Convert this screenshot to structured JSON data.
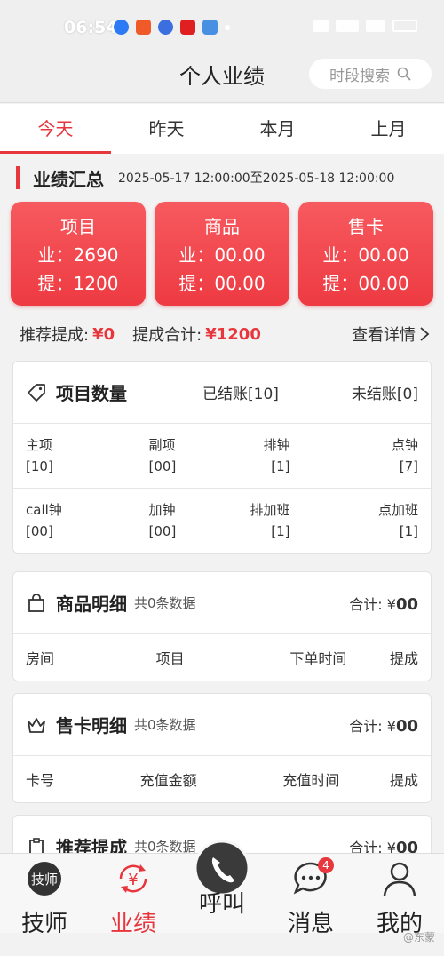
{
  "status": {
    "time": "06:54"
  },
  "header": {
    "title": "个人业绩",
    "search_label": "时段搜索"
  },
  "tabs": [
    {
      "label": "今天",
      "active": true
    },
    {
      "label": "昨天",
      "active": false
    },
    {
      "label": "本月",
      "active": false
    },
    {
      "label": "上月",
      "active": false
    }
  ],
  "summary": {
    "title": "业绩汇总",
    "range": "2025-05-17 12:00:00至2025-05-18 12:00:00"
  },
  "cards": [
    {
      "title": "项目",
      "ye": "业：2690",
      "ti": "提：1200"
    },
    {
      "title": "商品",
      "ye": "业：00.00",
      "ti": "提：00.00"
    },
    {
      "title": "售卡",
      "ye": "业：00.00",
      "ti": "提：00.00"
    }
  ],
  "stats": {
    "recommend_label": "推荐提成:",
    "recommend_value": "¥0",
    "total_label": "提成合计:",
    "total_value": "¥1200",
    "detail_label": "查看详情"
  },
  "items_panel": {
    "title": "项目数量",
    "settled": "已结账[10]",
    "unsettled": "未结账[0]",
    "rows": [
      [
        {
          "label": "主项",
          "value": "[10]"
        },
        {
          "label": "副项",
          "value": "[00]"
        },
        {
          "label": "排钟",
          "value": "[1]"
        },
        {
          "label": "点钟",
          "value": "[7]"
        }
      ],
      [
        {
          "label": "call钟",
          "value": "[00]"
        },
        {
          "label": "加钟",
          "value": "[00]"
        },
        {
          "label": "排加班",
          "value": "[1]"
        },
        {
          "label": "点加班",
          "value": "[1]"
        }
      ]
    ]
  },
  "goods_panel": {
    "title": "商品明细",
    "count": "共0条数据",
    "sum_label": "合计: ¥",
    "sum_value": "00",
    "columns": [
      "房间",
      "项目",
      "下单时间",
      "提成"
    ]
  },
  "card_panel": {
    "title": "售卡明细",
    "count": "共0条数据",
    "sum_label": "合计: ¥",
    "sum_value": "00",
    "columns": [
      "卡号",
      "充值金额",
      "充值时间",
      "提成"
    ]
  },
  "recommend_panel": {
    "title": "推荐提成",
    "count": "共0条数据",
    "sum_label": "合计: ¥",
    "sum_value": "00"
  },
  "nav": [
    {
      "label": "技师",
      "icon_text": "技师",
      "active": false
    },
    {
      "label": "业绩",
      "icon_text": "¥",
      "active": true
    },
    {
      "label": "呼叫",
      "active": false
    },
    {
      "label": "消息",
      "badge": "4",
      "active": false
    },
    {
      "label": "我的",
      "active": false
    }
  ],
  "watermark": "@东蒙",
  "colors": {
    "accent": "#e8363d"
  }
}
